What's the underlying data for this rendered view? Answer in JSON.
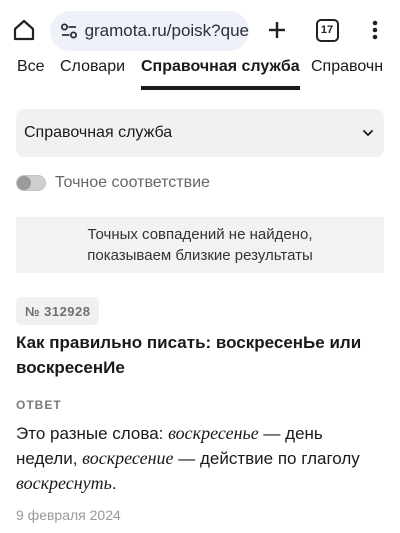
{
  "browser": {
    "url": "gramota.ru/poisk?que",
    "tab_count": "17",
    "icons": {
      "home": "home-icon",
      "site": "site-settings-icon",
      "new_tab": "plus-icon",
      "tabs": "tabs-icon",
      "menu": "more-vert-icon"
    }
  },
  "category_tabs": [
    {
      "label": "Все"
    },
    {
      "label": "Словари"
    },
    {
      "label": "Справочная служба"
    },
    {
      "label": "Справочн"
    }
  ],
  "filter": {
    "select_value": "Справочная служба",
    "exact_match_label": "Точное соответствие",
    "exact_match_on": false
  },
  "notice": {
    "line1": "Точных совпадений не найдено,",
    "line2": "показываем близкие результаты"
  },
  "result": {
    "number": "№ 312928",
    "title": "Как правильно писать: воскресенЬе или воскресенИе",
    "answer_label": "ОТВЕТ",
    "answer_parts": {
      "p1": "Это разные слова: ",
      "w1": "воскресенье",
      "p2": " — день недели, ",
      "w2": "воскресение",
      "p3": " — действие по глаголу ",
      "w3": "воскреснуть",
      "p4": "."
    },
    "date": "9 февраля 2024"
  },
  "colors": {
    "accent": "#1a1a1a",
    "muted": "#9a9a9a",
    "panel": "#f2f2f2",
    "urlbar": "#eef1f7"
  }
}
